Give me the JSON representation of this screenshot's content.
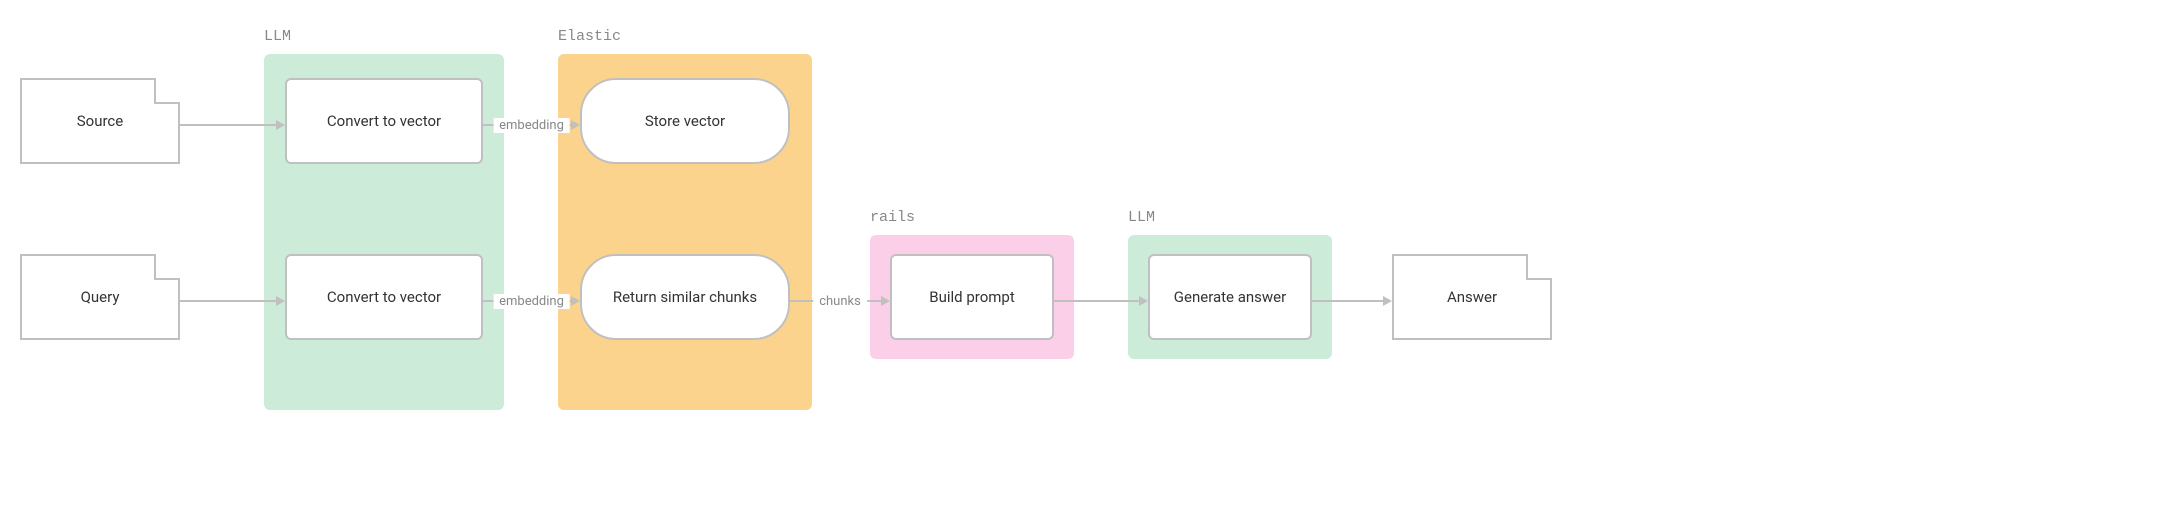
{
  "groups": {
    "llm1": {
      "label": "LLM"
    },
    "elastic": {
      "label": "Elastic"
    },
    "rails": {
      "label": "rails"
    },
    "llm2": {
      "label": "LLM"
    }
  },
  "nodes": {
    "source": {
      "label": "Source"
    },
    "query": {
      "label": "Query"
    },
    "conv1": {
      "label": "Convert to vector"
    },
    "conv2": {
      "label": "Convert to vector"
    },
    "store": {
      "label": "Store vector"
    },
    "return": {
      "label": "Return similar chunks"
    },
    "build": {
      "label": "Build prompt"
    },
    "generate": {
      "label": "Generate answer"
    },
    "answer": {
      "label": "Answer"
    }
  },
  "arrows": {
    "a_src_conv1": {
      "label": ""
    },
    "a_qry_conv2": {
      "label": ""
    },
    "a_conv1_store": {
      "label": "embedding"
    },
    "a_conv2_ret": {
      "label": "embedding"
    },
    "a_ret_build": {
      "label": "chunks"
    },
    "a_build_gen": {
      "label": ""
    },
    "a_gen_ans": {
      "label": ""
    }
  }
}
